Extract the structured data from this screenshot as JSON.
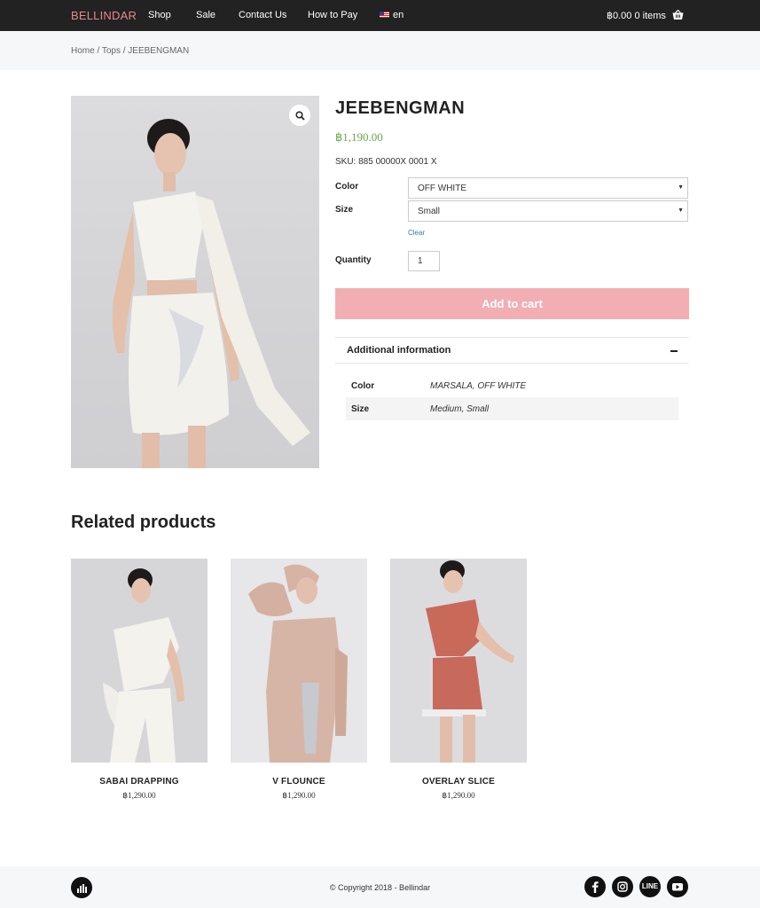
{
  "header": {
    "brand": "BELLINDAR",
    "nav": [
      "Shop",
      "Sale",
      "Contact Us",
      "How to Pay"
    ],
    "language": "en",
    "cart": "฿0.00 0 items"
  },
  "breadcrumb": "Home / Tops / JEEBENGMAN",
  "product": {
    "title": "JEEBENGMAN",
    "price": "฿1,190.00",
    "sku": "SKU: 885 00000X 0001 X",
    "color_label": "Color",
    "color_value": "OFF WHITE",
    "size_label": "Size",
    "size_value": "Small",
    "clear": "Clear",
    "quantity_label": "Quantity",
    "quantity": "1",
    "add_to_cart": "Add to cart"
  },
  "additional_info": {
    "title": "Additional information",
    "rows": [
      {
        "key": "Color",
        "value": "MARSALA, OFF WHITE"
      },
      {
        "key": "Size",
        "value": "Medium, Small"
      }
    ]
  },
  "related": {
    "title": "Related products",
    "items": [
      {
        "name": "SABAI DRAPPING",
        "price": "฿1,290.00"
      },
      {
        "name": "V FLOUNCE",
        "price": "฿1,290.00"
      },
      {
        "name": "OVERLAY SLICE",
        "price": "฿1,290.00"
      }
    ]
  },
  "footer": {
    "copyright": "© Copyright 2018 - Bellindar",
    "social": [
      "facebook-icon",
      "instagram-icon",
      "line-icon",
      "youtube-icon"
    ],
    "line_label": "LINE"
  },
  "colors": {
    "brand": "#e8868e",
    "price": "#6aa84f",
    "add_to_cart": "#f2aeb3",
    "topbar": "#222222"
  }
}
